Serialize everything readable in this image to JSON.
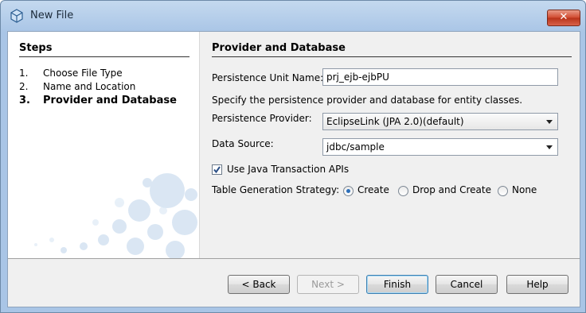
{
  "window": {
    "title": "New File",
    "close_symbol": "✕"
  },
  "steps": {
    "heading": "Steps",
    "items": [
      {
        "num": "1.",
        "label": "Choose File Type"
      },
      {
        "num": "2.",
        "label": "Name and Location"
      },
      {
        "num": "3.",
        "label": "Provider and Database"
      }
    ]
  },
  "form": {
    "heading": "Provider and Database",
    "pu_name_label": "Persistence Unit Name:",
    "pu_name_value": "prj_ejb-ejbPU",
    "hint": "Specify the persistence provider and database for entity classes.",
    "provider_label": "Persistence Provider:",
    "provider_value": "EclipseLink (JPA 2.0)(default)",
    "datasource_label": "Data Source:",
    "datasource_value": "jdbc/sample",
    "jta_label": "Use Java Transaction APIs",
    "jta_checked": true,
    "table_gen_label": "Table Generation Strategy:",
    "table_gen_options": [
      "Create",
      "Drop and Create",
      "None"
    ],
    "table_gen_selected": "Create"
  },
  "buttons": {
    "back": "< Back",
    "next": "Next >",
    "finish": "Finish",
    "cancel": "Cancel",
    "help": "Help"
  }
}
